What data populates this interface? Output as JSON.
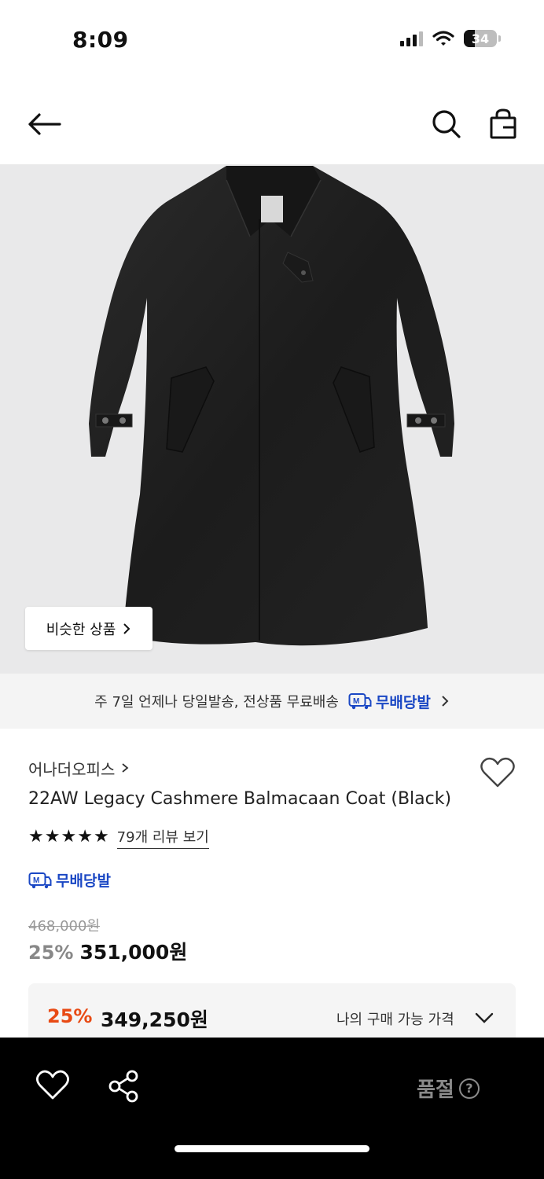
{
  "status_bar": {
    "time": "8:09",
    "battery": "34"
  },
  "nav": {
    "back_icon": "arrow-left-icon",
    "search_icon": "search-icon",
    "bag_icon": "shopping-bag-icon"
  },
  "image": {
    "similar_button": "비슷한 상품"
  },
  "delivery_banner": {
    "text": "주 7일 언제나 당일발송, 전상품 무료배송",
    "badge": "무배당발"
  },
  "product": {
    "brand": "어나더오피스",
    "name": "22AW Legacy Cashmere Balmacaan Coat (Black)",
    "review_link": "79개 리뷰 보기",
    "rating_stars": 5,
    "badge": "무배당발",
    "original_price": "468,000원",
    "discount": "25%",
    "price": "351,000원"
  },
  "my_price": {
    "discount": "25%",
    "price": "349,250원",
    "label": "나의 구매 가능 가격"
  },
  "bottom_bar": {
    "sold_out": "품절",
    "help_icon_text": "?"
  },
  "colors": {
    "accent_blue": "#1a47c4",
    "discount_orange": "#e84a14",
    "bottom_bg": "#000000"
  }
}
